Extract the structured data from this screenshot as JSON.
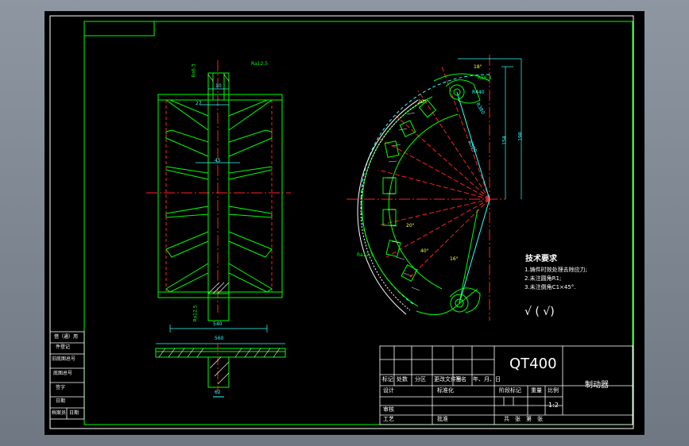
{
  "title_block": {
    "material": "QT400",
    "part_name": "制动器",
    "scale": "1:2",
    "stage_label": "阶段标记",
    "weight_label": "重量",
    "ratio_label": "比例",
    "sheet_label": "共　张　第　张",
    "mark_label": "标记",
    "count_label": "处数",
    "zone_label": "分区",
    "change_doc_label": "更改文件号",
    "sign_label": "签名",
    "date_label": "年、月、日",
    "design_label": "设计",
    "standardize_label": "标准化",
    "review_label": "审核",
    "process_label": "工艺",
    "approve_label": "批准"
  },
  "side_table": [
    "借（通）用",
    "件登记",
    "旧底图总号",
    "底图总号",
    "签字",
    "日期",
    "档案员",
    "日期"
  ],
  "tech_requirements": {
    "title": "技术要求",
    "items": [
      "1.铸件时效处理去除应力;",
      "2.未注圆角R1;",
      "3.未注倒角C1×45°."
    ]
  },
  "roughness_symbol": "√ ( √)",
  "dimensions": {
    "width_total": "560",
    "width_inner": "540",
    "hub_bottom": "62",
    "hub_top": "10",
    "hub_mid": "45",
    "small_top": "27",
    "roughness_1": "Ra12.5",
    "roughness_2": "Ra6.3",
    "roughness_3": "Ra12.5",
    "roughness_4": "Ra6.3",
    "roughness_5": "Ra12.5",
    "arc_r1": "R440",
    "arc_r2": "R500",
    "arc_r3": "R380",
    "angle_1": "18°",
    "angle_2": "20°",
    "angle_3": "20°",
    "angle_4": "40°",
    "angle_5": "16°",
    "height_1": "154",
    "height_2": "198"
  },
  "colors": {
    "outline": "#00ff00",
    "center": "#ff2020",
    "dim": "#33ffff",
    "hatch": "#ffffff"
  }
}
